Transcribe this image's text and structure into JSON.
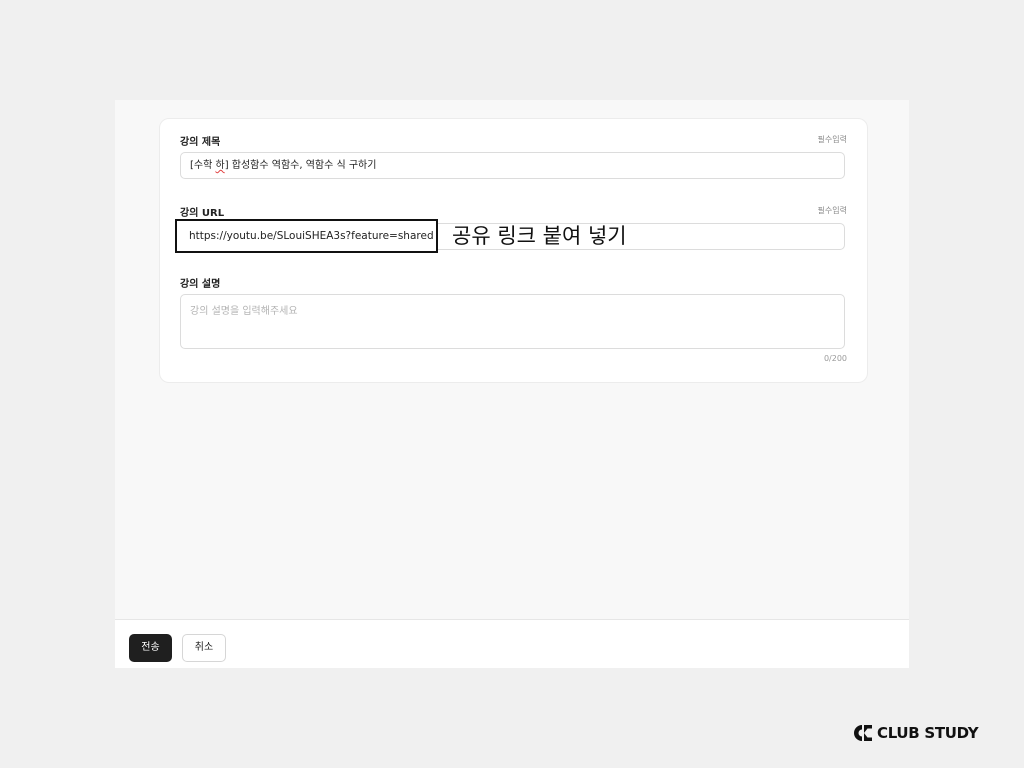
{
  "form": {
    "title_field": {
      "label": "강의 제목",
      "required_tag": "필수입력",
      "value_prefix": "[수학 ",
      "value_misspelled": "하",
      "value_suffix": "] 합성함수 역함수, 역함수 식 구하기"
    },
    "url_field": {
      "label": "강의 URL",
      "required_tag": "필수입력",
      "value": "https://youtu.be/SLouiSHEA3s?feature=shared"
    },
    "description_field": {
      "label": "강의 설명",
      "placeholder": "강의 설명을 입력해주세요",
      "counter": "0/200"
    }
  },
  "annotation": {
    "text": "공유 링크 붙여 넣기"
  },
  "footer": {
    "submit_label": "전송",
    "cancel_label": "취소"
  },
  "brand": {
    "logo_text": "CLUB STUDY"
  }
}
